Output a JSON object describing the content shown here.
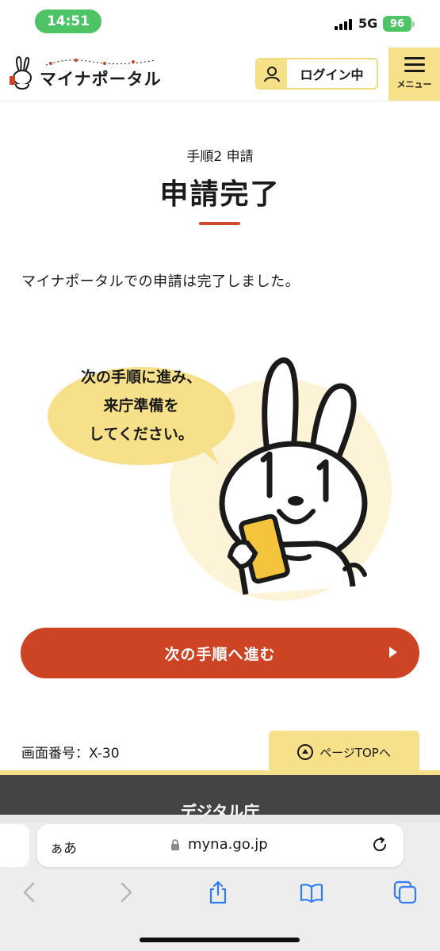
{
  "status_bar": {
    "time": "14:51",
    "network": "5G",
    "battery": "96"
  },
  "header": {
    "logo_text": "マイナポータル",
    "login_label": "ログイン中",
    "menu_label": "メニュー"
  },
  "content": {
    "step_label": "手順2 申請",
    "title": "申請完了",
    "message": "マイナポータルでの申請は完了しました。",
    "bubble_lines": [
      "次の手順に進み、",
      "来庁準備を",
      "してください。"
    ],
    "next_button_label": "次の手順へ進む"
  },
  "footer_bar": {
    "screen_id": "画面番号：X-30",
    "page_top_label": "ページTOPへ",
    "agency": "デジタル庁"
  },
  "browser": {
    "text_size_label": "ぁあ",
    "url": "myna.go.jp"
  },
  "colors": {
    "accent_red": "#cd4424",
    "accent_yellow": "#f6e08a",
    "status_green": "#4fc467"
  }
}
